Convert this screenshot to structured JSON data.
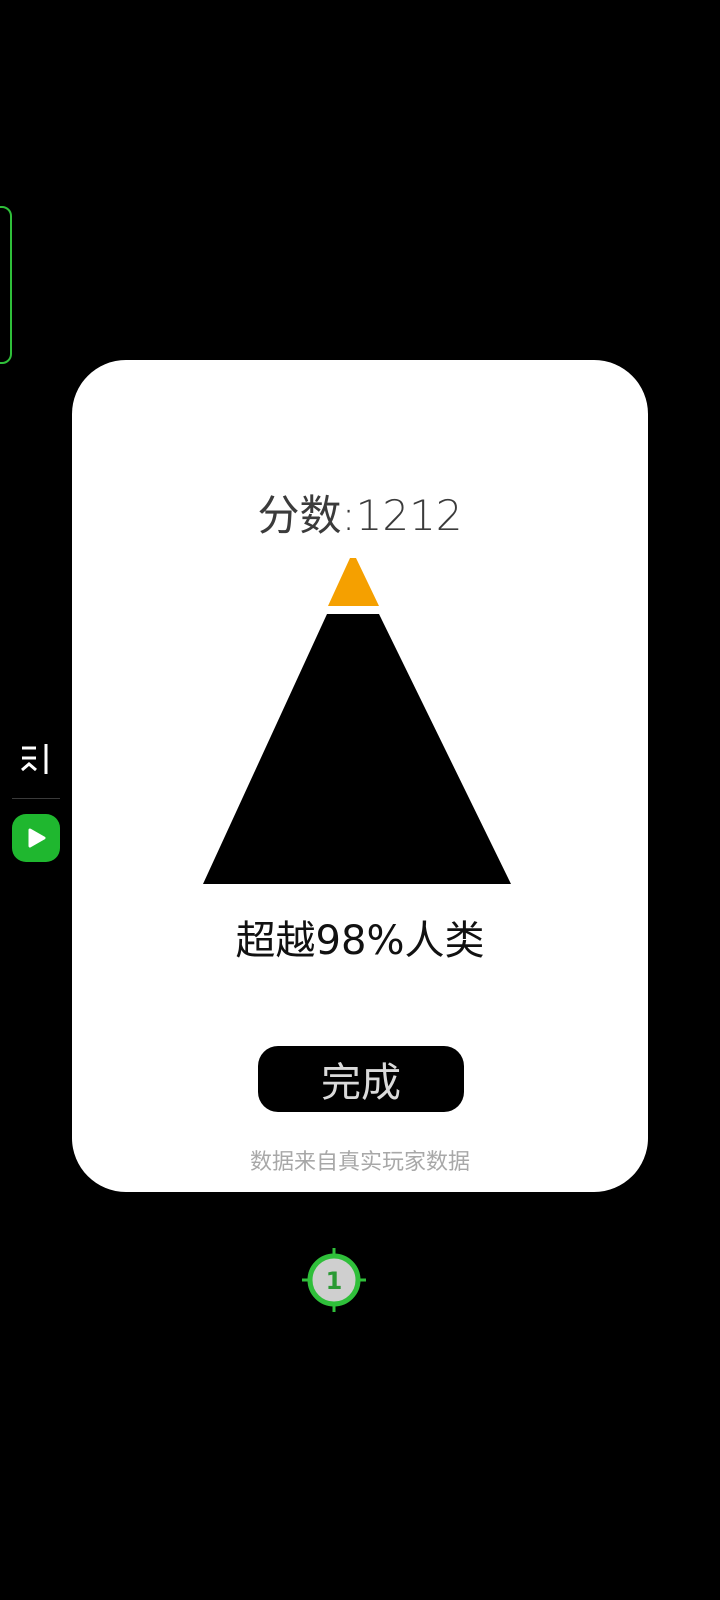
{
  "result_card": {
    "score_text": "分数:1212",
    "beat_text": "超越98%人类",
    "done_label": "完成",
    "source_note": "数据来自真实玩家数据"
  },
  "pyramid": {
    "percentile": 98,
    "fill_color": "#000000",
    "top_color": "#f5a000"
  },
  "side_menu": {
    "menu_icon": "collapse-menu-icon",
    "play_icon": "play-icon",
    "accent": "#1fb72f"
  },
  "touch_marker": {
    "label": "1",
    "color": "#2fbf3a"
  }
}
